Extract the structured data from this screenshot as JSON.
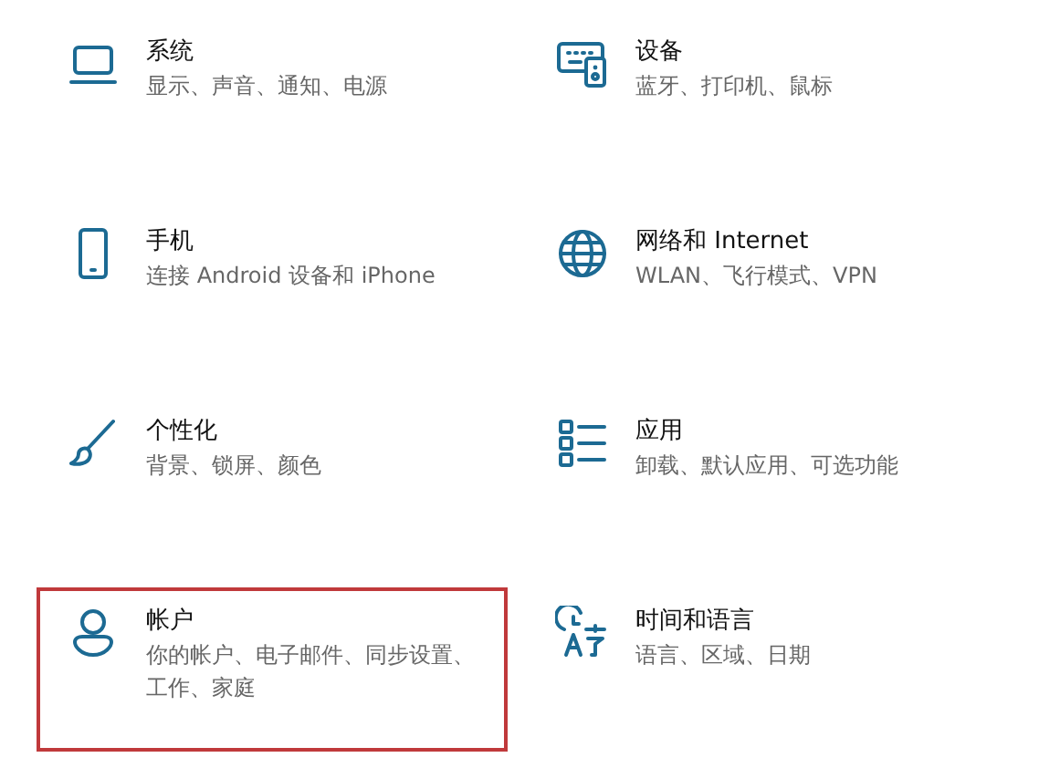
{
  "categories": [
    {
      "title": "系统",
      "description": "显示、声音、通知、电源",
      "highlighted": false
    },
    {
      "title": "设备",
      "description": "蓝牙、打印机、鼠标",
      "highlighted": false
    },
    {
      "title": "手机",
      "description": "连接 Android 设备和 iPhone",
      "highlighted": false
    },
    {
      "title": "网络和 Internet",
      "description": "WLAN、飞行模式、VPN",
      "highlighted": false
    },
    {
      "title": "个性化",
      "description": "背景、锁屏、颜色",
      "highlighted": false
    },
    {
      "title": "应用",
      "description": "卸载、默认应用、可选功能",
      "highlighted": false
    },
    {
      "title": "帐户",
      "description": "你的帐户、电子邮件、同步设置、工作、家庭",
      "highlighted": true
    },
    {
      "title": "时间和语言",
      "description": "语言、区域、日期",
      "highlighted": false
    }
  ]
}
